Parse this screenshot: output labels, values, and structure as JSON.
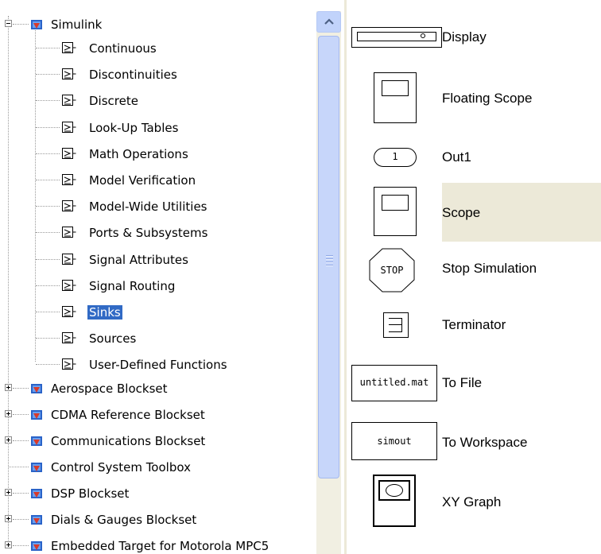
{
  "tree": {
    "root": {
      "label": "Simulink",
      "expanded": true
    },
    "sublibraries": [
      {
        "label": "Continuous"
      },
      {
        "label": "Discontinuities"
      },
      {
        "label": "Discrete"
      },
      {
        "label": "Look-Up Tables"
      },
      {
        "label": "Math Operations"
      },
      {
        "label": "Model Verification"
      },
      {
        "label": "Model-Wide Utilities"
      },
      {
        "label": "Ports & Subsystems"
      },
      {
        "label": "Signal Attributes"
      },
      {
        "label": "Signal Routing"
      },
      {
        "label": "Sinks",
        "selected": true
      },
      {
        "label": "Sources"
      },
      {
        "label": "User-Defined Functions"
      }
    ],
    "libraries": [
      {
        "label": "Aerospace Blockset",
        "expandable": true
      },
      {
        "label": "CDMA Reference Blockset",
        "expandable": true
      },
      {
        "label": "Communications Blockset",
        "expandable": true
      },
      {
        "label": "Control System Toolbox",
        "expandable": false
      },
      {
        "label": "DSP Blockset",
        "expandable": true
      },
      {
        "label": "Dials & Gauges Blockset",
        "expandable": true
      },
      {
        "label": "Embedded Target for Motorola MPC5",
        "expandable": true
      }
    ]
  },
  "blocks": [
    {
      "label": "Display",
      "icon": "display-block-icon"
    },
    {
      "label": "Floating Scope",
      "icon": "floating-scope-block-icon"
    },
    {
      "label": "Out1",
      "icon": "outport-block-icon",
      "icon_text": "1"
    },
    {
      "label": "Scope",
      "icon": "scope-block-icon",
      "selected": true
    },
    {
      "label": "Stop Simulation",
      "icon": "stop-block-icon",
      "icon_text": "STOP"
    },
    {
      "label": "Terminator",
      "icon": "terminator-block-icon"
    },
    {
      "label": "To File",
      "icon": "to-file-block-icon",
      "icon_text": "untitled.mat"
    },
    {
      "label": "To Workspace",
      "icon": "to-workspace-block-icon",
      "icon_text": "simout"
    },
    {
      "label": "XY Graph",
      "icon": "xy-graph-block-icon"
    }
  ],
  "colors": {
    "selection": "#316ac5",
    "selected_block_bg": "#ece9d8",
    "scrollbar_thumb": "#c7d6fa",
    "library_icon": "#2a63c8",
    "library_icon_accent": "#d83a2a"
  }
}
